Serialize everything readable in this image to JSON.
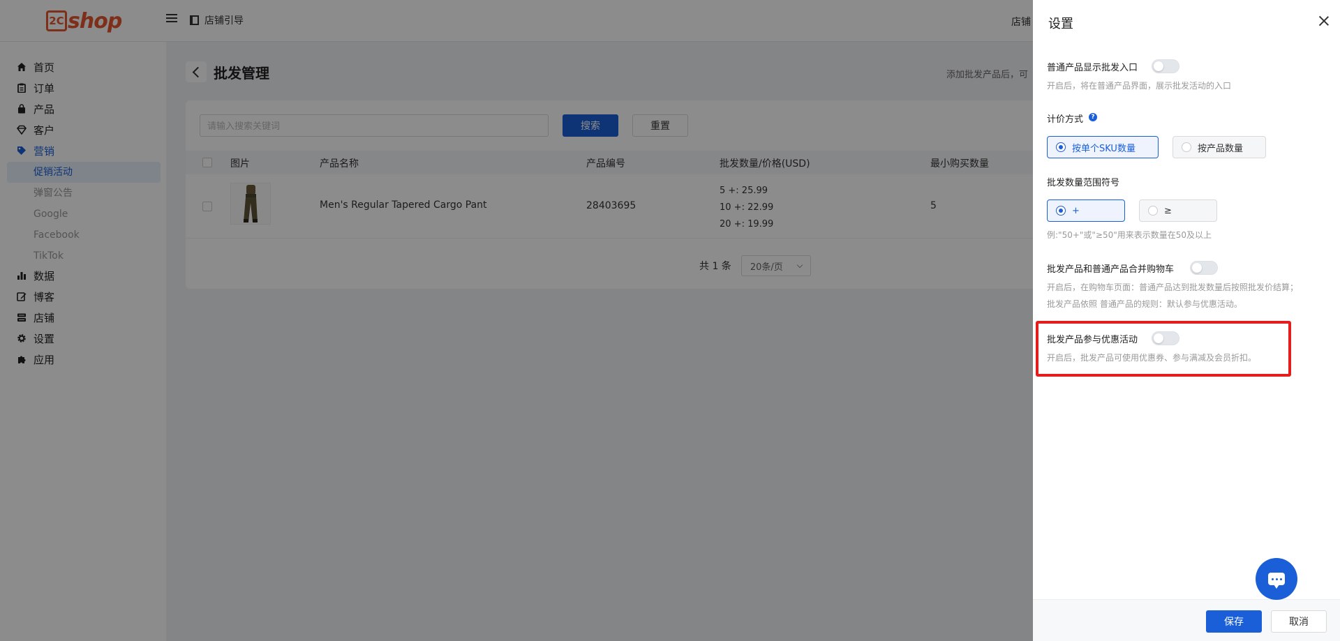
{
  "header": {
    "logo_mark": "2C",
    "logo_text": "shop",
    "guide_label": "店铺引导",
    "store_label": "店铺"
  },
  "sidebar": {
    "items": [
      {
        "label": "首页",
        "icon": "home-icon"
      },
      {
        "label": "订单",
        "icon": "clipboard-icon"
      },
      {
        "label": "产品",
        "icon": "bag-icon"
      },
      {
        "label": "客户",
        "icon": "diamond-icon"
      },
      {
        "label": "营销",
        "icon": "tag-icon",
        "active": true
      },
      {
        "label": "数据",
        "icon": "bar-chart-icon"
      },
      {
        "label": "博客",
        "icon": "edit-icon"
      },
      {
        "label": "店铺",
        "icon": "store-icon"
      },
      {
        "label": "设置",
        "icon": "gear-icon"
      },
      {
        "label": "应用",
        "icon": "puzzle-icon"
      }
    ],
    "marketing_sub": [
      "促销活动",
      "弹窗公告",
      "Google",
      "Facebook",
      "TikTok"
    ]
  },
  "page": {
    "title": "批发管理",
    "hint": "添加批发产品后，可"
  },
  "search": {
    "placeholder": "请输入搜索关键词",
    "search_label": "搜索",
    "reset_label": "重置"
  },
  "table": {
    "columns": [
      "图片",
      "产品名称",
      "产品编号",
      "批发数量/价格(USD)",
      "最小购买数量"
    ],
    "rows": [
      {
        "name": "Men's Regular Tapered Cargo Pant",
        "sku": "28403695",
        "tiers": [
          "5 +: 25.99",
          "10 +: 22.99",
          "20 +: 19.99"
        ],
        "min_qty": "5"
      }
    ]
  },
  "pagination": {
    "total": "共 1 条",
    "page_size": "20条/页"
  },
  "drawer": {
    "title": "设置",
    "show_entry": {
      "label": "普通产品显示批发入口",
      "desc": "开启后，将在普通产品界面，展示批发活动的入口",
      "enabled": false
    },
    "pricing": {
      "label": "计价方式",
      "options": [
        "按单个SKU数量",
        "按产品数量"
      ],
      "selected": 0
    },
    "range_symbol": {
      "label": "批发数量范围符号",
      "options": [
        "+",
        "≥"
      ],
      "selected": 0,
      "example": "例:\"50+\"或\"≥50\"用来表示数量在50及以上"
    },
    "merge_cart": {
      "label": "批发产品和普通产品合并购物车",
      "desc_line1": "开启后，在购物车页面：普通产品达到批发数量后按照批发价结算；",
      "desc_line2": "批发产品依照 普通产品的规则：默认参与优惠活动。",
      "enabled": false
    },
    "join_promo": {
      "label": "批发产品参与优惠活动",
      "desc": "开启后，批发产品可使用优惠券、参与满减及会员折扣。",
      "enabled": false
    },
    "save_label": "保存",
    "cancel_label": "取消"
  },
  "colors": {
    "primary": "#1a5fd8",
    "brand": "#e4572e",
    "highlight": "#e41e1e"
  }
}
